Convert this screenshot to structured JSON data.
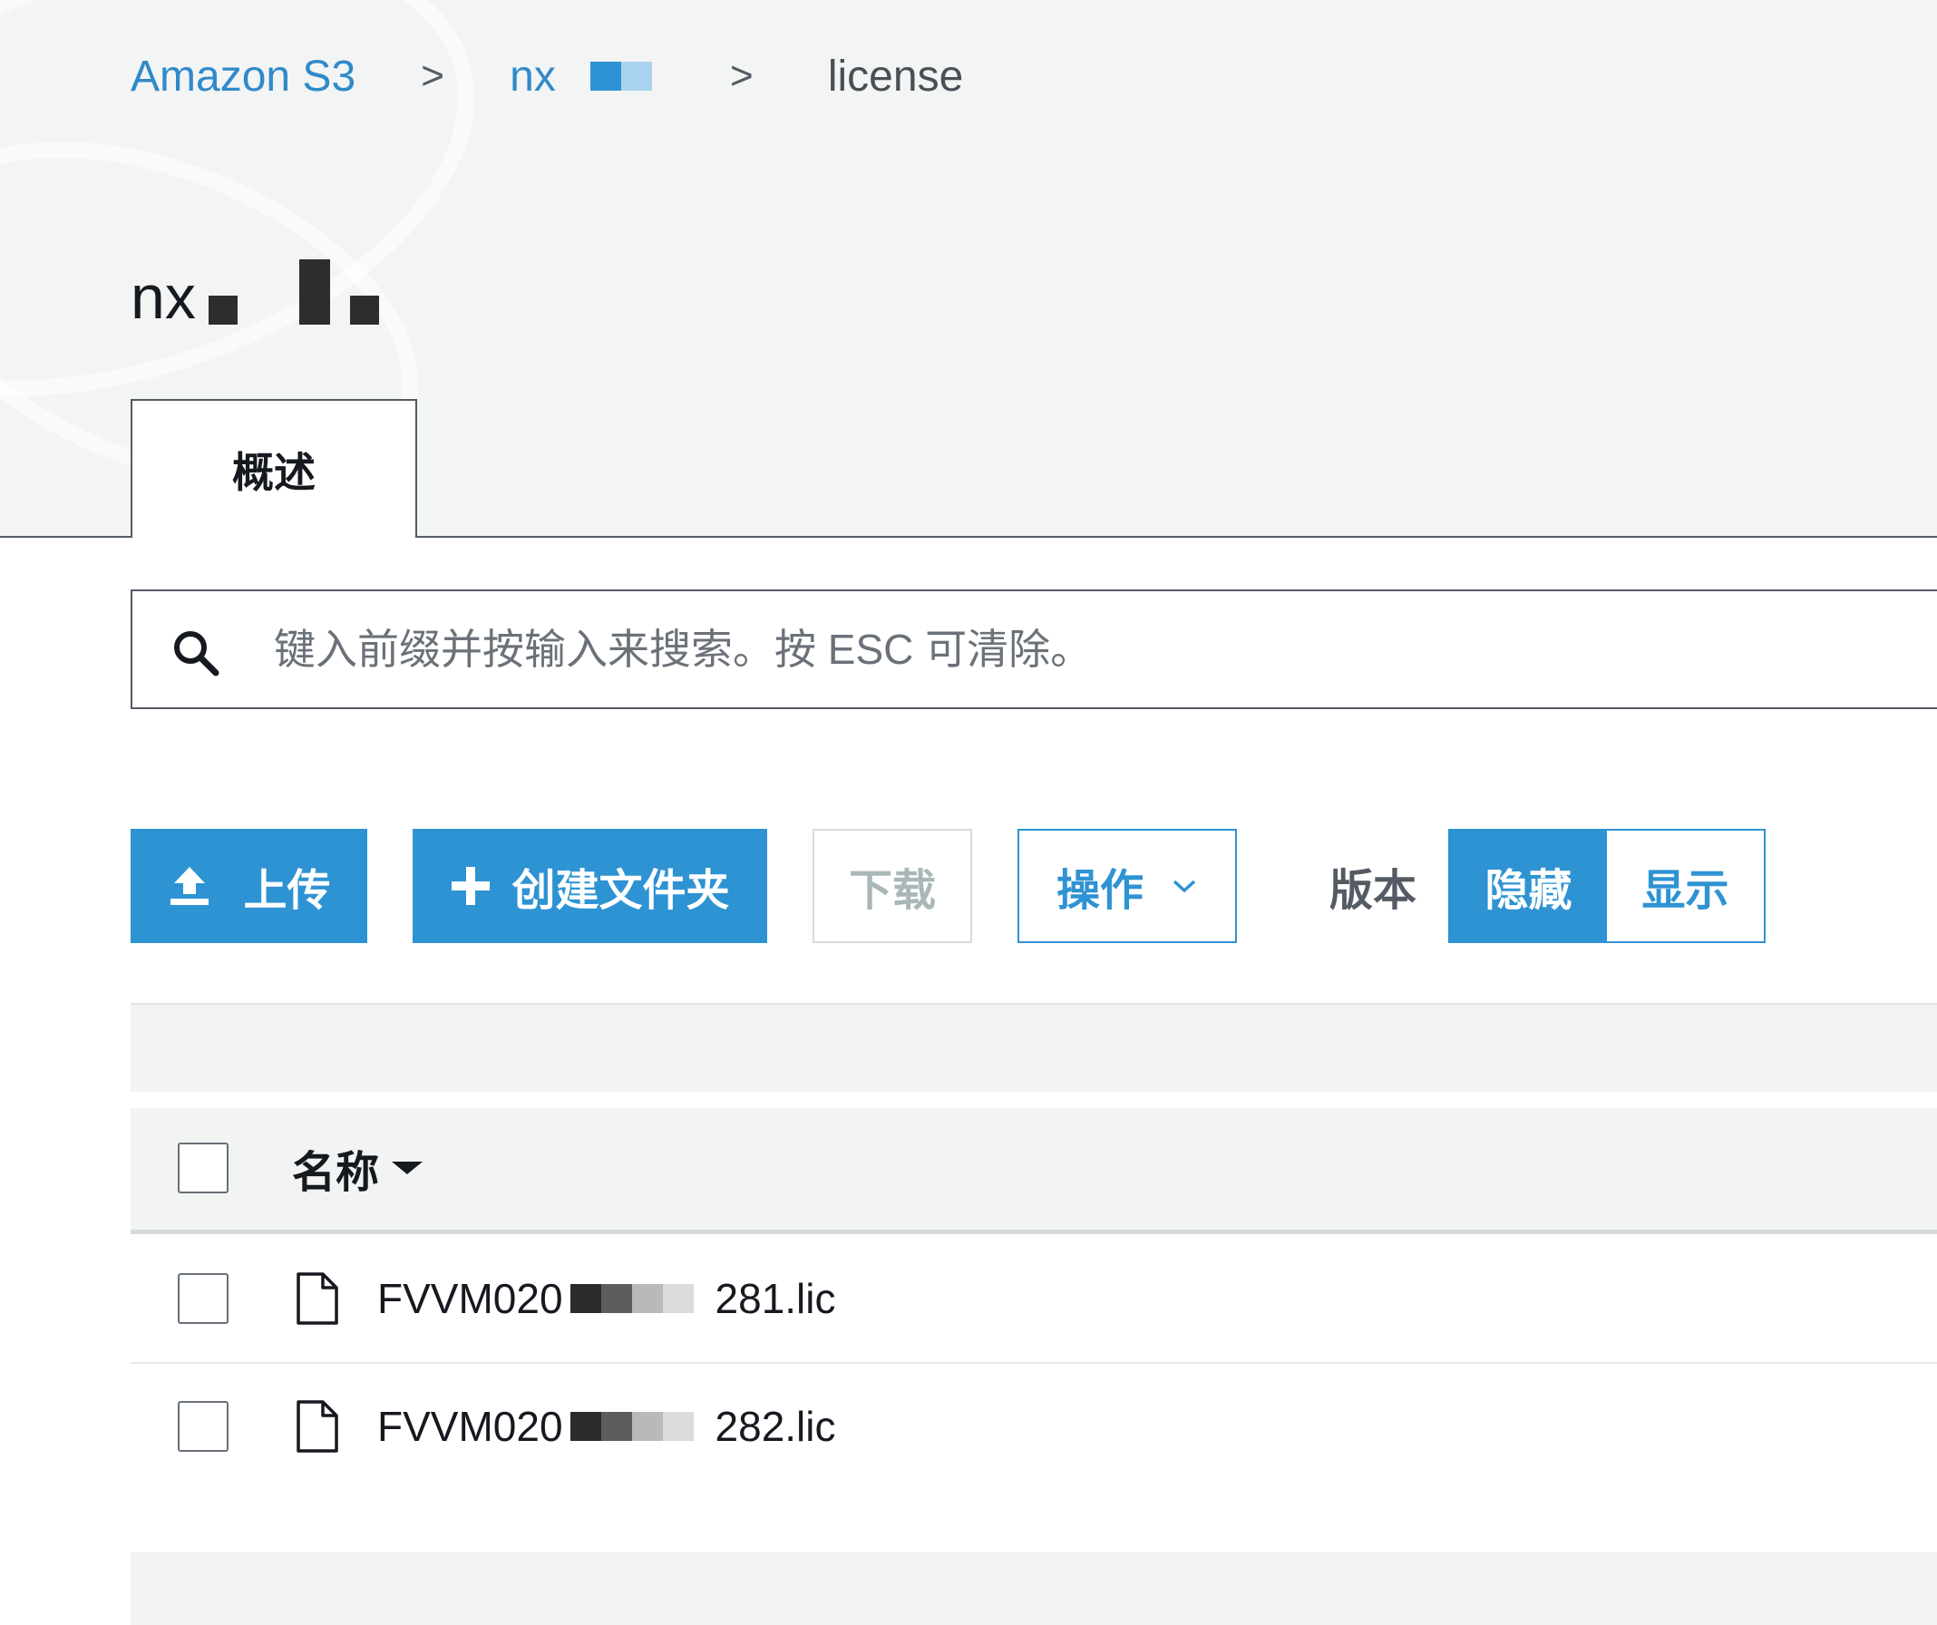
{
  "breadcrumb": {
    "root": "Amazon S3",
    "separator": ">",
    "bucket": "nx",
    "current": "license"
  },
  "page": {
    "title": "nx"
  },
  "tabs": [
    {
      "label": "概述",
      "active": true
    }
  ],
  "search": {
    "placeholder": "键入前缀并按输入来搜索。按 ESC 可清除。",
    "value": ""
  },
  "toolbar": {
    "upload_label": "上传",
    "create_folder_label": "创建文件夹",
    "download_label": "下载",
    "actions_label": "操作",
    "version_label": "版本",
    "version_hide_label": "隐藏",
    "version_show_label": "显示",
    "version_selected": "隐藏"
  },
  "table": {
    "columns": [
      {
        "label": "名称",
        "sort": "descending"
      }
    ],
    "rows": [
      {
        "prefix": "FVVM020",
        "suffix": "281.lic",
        "icon": "file-icon"
      },
      {
        "prefix": "FVVM020",
        "suffix": "282.lic",
        "icon": "file-icon"
      }
    ]
  },
  "colors": {
    "accent": "#2e93d3",
    "header_bg": "#f3f4f4",
    "border": "#545b64",
    "disabled_text": "#aab7b8"
  }
}
